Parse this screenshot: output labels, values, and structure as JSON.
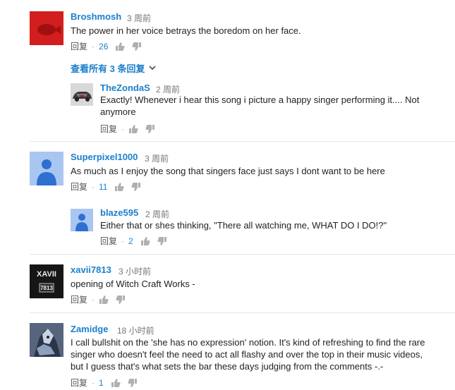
{
  "comments": [
    {
      "author": "Broshmosh",
      "time": "3 周前",
      "text": "The power in her voice betrays the boredom on her face.",
      "reply_label": "回复",
      "likes": "26",
      "avatar_color": "#d21e1e"
    },
    {
      "author": "TheZondaS",
      "time": "2 周前",
      "text": "Exactly! Whenever i hear this song i picture a happy singer performing it.... Not anymore",
      "reply_label": "回复",
      "likes": ""
    },
    {
      "author": "Superpixel1000",
      "time": "3 周前",
      "text": "As much as I enjoy the song that singers face just says I dont want to be here",
      "reply_label": "回复",
      "likes": "11",
      "avatar_color": "#a9c6f1"
    },
    {
      "author": "blaze595",
      "time": "2 周前",
      "text": "Either that or shes thinking, \"There all watching me, WHAT DO I DO!?\"",
      "reply_label": "回复",
      "likes": "2",
      "avatar_color": "#a9c6f1"
    },
    {
      "author": "xavii7813",
      "time": "3 小时前",
      "text": "opening of Witch Craft Works -",
      "reply_label": "回复",
      "likes": "",
      "avatar_text_top": "XAVII",
      "avatar_text_bottom": "7813"
    },
    {
      "author": "Zamidge",
      "time": "18 小时前",
      "text": "I call bullshit on the 'she has no expression' notion. It's kind of refreshing to find the rare singer who doesn't feel the need to act all flashy and over the top in their music videos, but I guess that's what sets the bar these days judging from the comments -.-",
      "reply_label": "回复",
      "likes": "1"
    }
  ],
  "view_replies": "查看所有 3 条回复",
  "colors": {
    "link": "#1b7fcc",
    "divider": "#e5e5e5"
  }
}
